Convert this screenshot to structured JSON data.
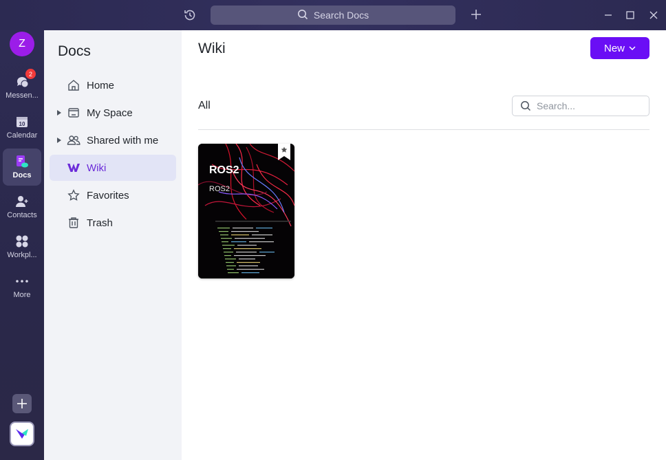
{
  "titlebar": {
    "search_placeholder": "Search Docs"
  },
  "rail": {
    "avatar_initial": "Z",
    "items": [
      {
        "label": "Messen...",
        "icon": "messenger-icon",
        "badge": "2"
      },
      {
        "label": "Calendar",
        "icon": "calendar-icon",
        "date": "10"
      },
      {
        "label": "Docs",
        "icon": "docs-icon",
        "active": true
      },
      {
        "label": "Contacts",
        "icon": "contacts-icon"
      },
      {
        "label": "Workpl...",
        "icon": "workplace-icon"
      },
      {
        "label": "More",
        "icon": "more-icon"
      }
    ]
  },
  "sidebar": {
    "title": "Docs",
    "items": [
      {
        "label": "Home",
        "icon": "home-icon"
      },
      {
        "label": "My Space",
        "icon": "folder-icon",
        "expandable": true
      },
      {
        "label": "Shared with me",
        "icon": "shared-users-icon",
        "expandable": true
      },
      {
        "label": "Wiki",
        "icon": "wiki-icon",
        "active": true
      },
      {
        "label": "Favorites",
        "icon": "star-icon"
      },
      {
        "label": "Trash",
        "icon": "trash-icon"
      }
    ]
  },
  "main": {
    "title": "Wiki",
    "new_button": "New",
    "filter": "All",
    "search_placeholder": "Search...",
    "cards": [
      {
        "title": "ROS2",
        "subtitle": "ROS2",
        "favorited": true
      }
    ]
  },
  "colors": {
    "accent": "#6a0ef5",
    "active_text": "#6b2bd9",
    "avatar": "#9b1de8",
    "badge": "#f23a3a"
  }
}
